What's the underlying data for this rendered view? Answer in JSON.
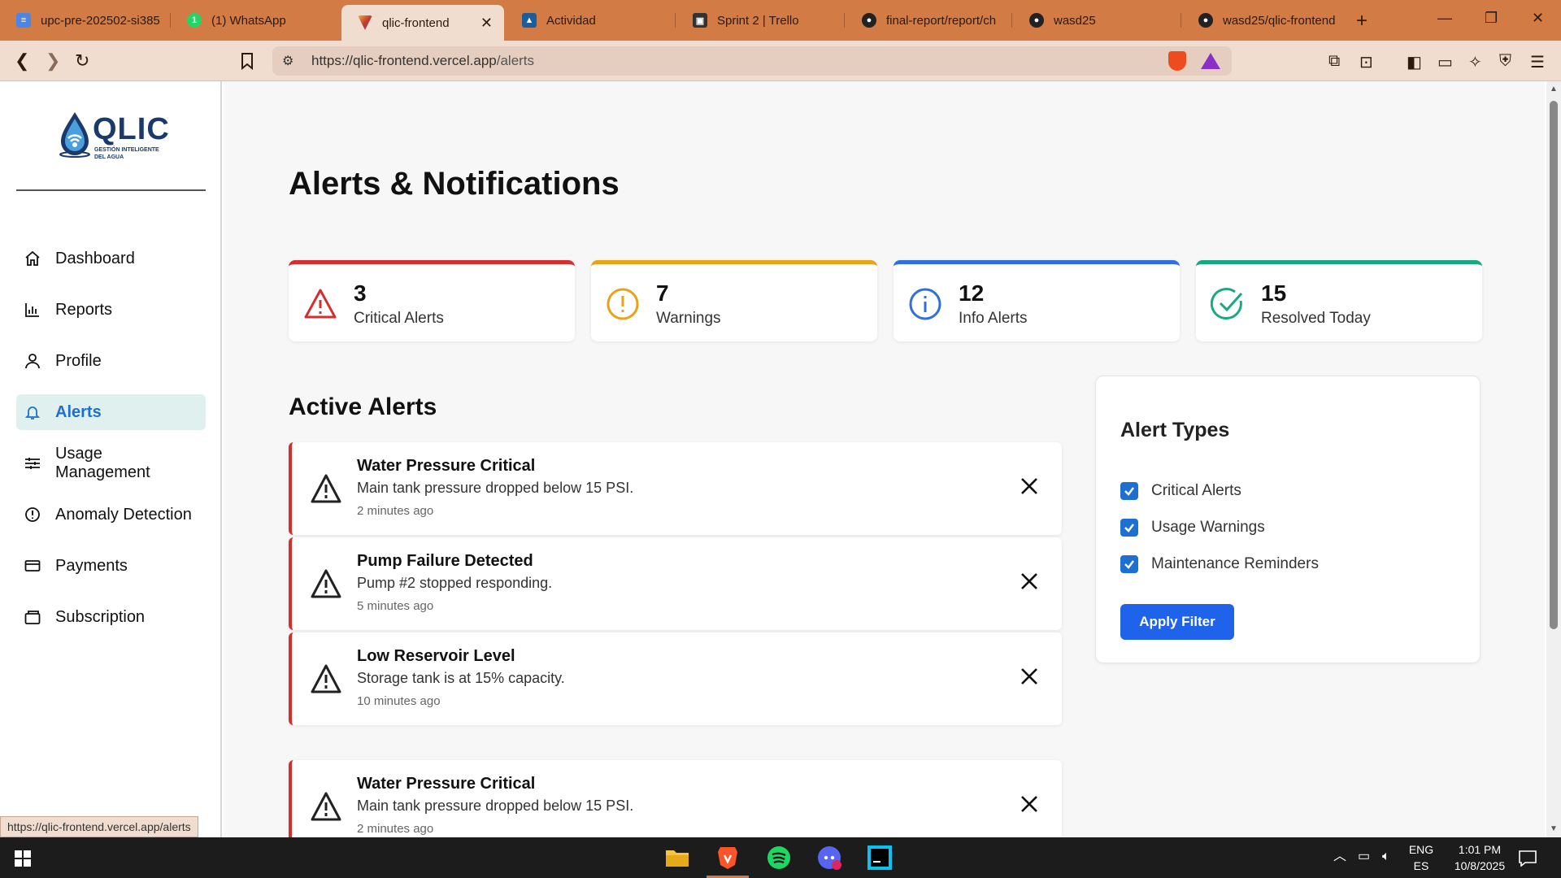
{
  "browser": {
    "tabs": [
      {
        "label": "upc-pre-202502-si385",
        "icon": "docs-icon"
      },
      {
        "label": "(1) WhatsApp",
        "icon": "whatsapp-icon"
      },
      {
        "label": "qlic-frontend",
        "icon": "vercel-icon"
      },
      {
        "label": "Actividad",
        "icon": "app-icon"
      },
      {
        "label": "Sprint 2 | Trello",
        "icon": "trello-icon"
      },
      {
        "label": "final-report/report/ch",
        "icon": "github-icon"
      },
      {
        "label": "wasd25",
        "icon": "github-icon"
      },
      {
        "label": "wasd25/qlic-frontend",
        "icon": "github-icon"
      }
    ],
    "active_tab_index": 2,
    "url_host": "https://qlic-frontend.vercel.app",
    "url_path": "/alerts",
    "status_url": "https://qlic-frontend.vercel.app/alerts"
  },
  "brand": {
    "name": "QLIC",
    "tagline": "GESTIÓN INTELIGENTE DEL AGUA"
  },
  "sidebar": {
    "items": [
      {
        "label": "Dashboard",
        "icon": "home-icon"
      },
      {
        "label": "Reports",
        "icon": "bar-chart-icon"
      },
      {
        "label": "Profile",
        "icon": "user-icon"
      },
      {
        "label": "Alerts",
        "icon": "bell-icon",
        "active": true
      },
      {
        "label": "Usage Management",
        "icon": "sliders-icon"
      },
      {
        "label": "Anomaly Detection",
        "icon": "alert-circle-icon"
      },
      {
        "label": "Payments",
        "icon": "credit-card-icon"
      },
      {
        "label": "Subscription",
        "icon": "subscription-icon"
      }
    ]
  },
  "page": {
    "title": "Alerts & Notifications",
    "stats": [
      {
        "value": "3",
        "label": "Critical Alerts",
        "color": "#d32f2f",
        "icon": "warning-triangle-icon"
      },
      {
        "value": "7",
        "label": "Warnings",
        "color": "#e8a317",
        "icon": "exclamation-circle-icon"
      },
      {
        "value": "12",
        "label": "Info Alerts",
        "color": "#2f6fdf",
        "icon": "info-circle-icon"
      },
      {
        "value": "15",
        "label": "Resolved Today",
        "color": "#1aa884",
        "icon": "check-circle-icon"
      }
    ],
    "active_alerts_title": "Active Alerts",
    "alerts": [
      {
        "title": "Water Pressure Critical",
        "message": "Main tank pressure dropped below 15 PSI.",
        "time": "2 minutes ago"
      },
      {
        "title": "Pump Failure Detected",
        "message": "Pump #2 stopped responding.",
        "time": "5 minutes ago"
      },
      {
        "title": "Low Reservoir Level",
        "message": "Storage tank is at 15% capacity.",
        "time": "10 minutes ago"
      },
      {
        "title": "Water Pressure Critical",
        "message": "Main tank pressure dropped below 15 PSI.",
        "time": "2 minutes ago"
      }
    ],
    "filter": {
      "title": "Alert Types",
      "options": [
        {
          "label": "Critical Alerts",
          "checked": true
        },
        {
          "label": "Usage Warnings",
          "checked": true
        },
        {
          "label": "Maintenance Reminders",
          "checked": true
        }
      ],
      "apply_label": "Apply Filter"
    }
  },
  "taskbar": {
    "lang_top": "ENG",
    "lang_bottom": "ES",
    "time": "1:01 PM",
    "date": "10/8/2025"
  },
  "colors": {
    "accent": "#1d6fd1",
    "critical": "#d32f2f",
    "browser_frame": "#d27b45"
  }
}
